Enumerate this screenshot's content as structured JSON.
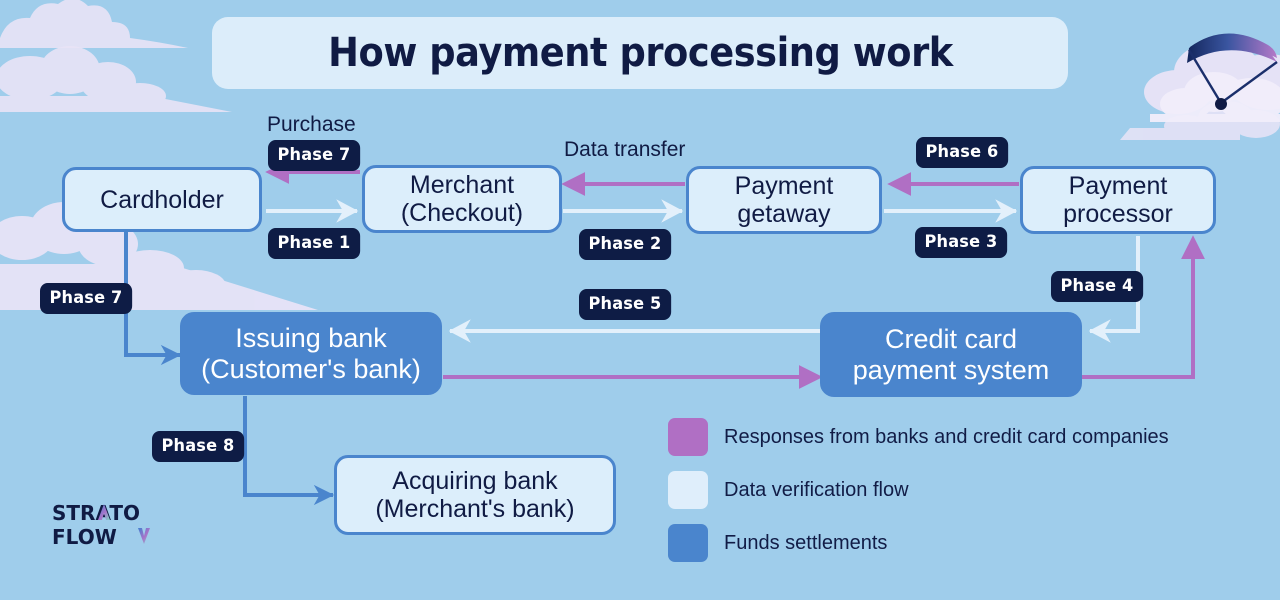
{
  "title": "How payment processing work",
  "background_color": "#9fcdeb",
  "colors": {
    "node_light_fill": "#dceefb",
    "node_border": "#4a85cd",
    "node_solid_fill": "#4a85cd",
    "chip_fill": "#0e1c45",
    "text_navy": "#101b44",
    "arrow_purple": "#b06fc4",
    "arrow_light": "#e3f0fb",
    "arrow_blue": "#4a85cd",
    "title_panel": "#dcedfa"
  },
  "nodes": [
    {
      "id": "cardholder",
      "line1": "Cardholder",
      "line2": ""
    },
    {
      "id": "merchant",
      "line1": "Merchant",
      "line2": "(Checkout)"
    },
    {
      "id": "gateway",
      "line1": "Payment",
      "line2": "getaway"
    },
    {
      "id": "processor",
      "line1": "Payment",
      "line2": "processor"
    },
    {
      "id": "issuing_bank",
      "line1": "Issuing bank",
      "line2": "(Customer's bank)"
    },
    {
      "id": "credit_card",
      "line1": "Credit card",
      "line2": "payment system"
    },
    {
      "id": "acquiring",
      "line1": "Acquiring bank",
      "line2": "(Merchant's bank)"
    }
  ],
  "phases": [
    {
      "id": "p1",
      "label": "Phase 1"
    },
    {
      "id": "p2",
      "label": "Phase 2"
    },
    {
      "id": "p3",
      "label": "Phase 3"
    },
    {
      "id": "p4",
      "label": "Phase 4"
    },
    {
      "id": "p5",
      "label": "Phase 5"
    },
    {
      "id": "p6",
      "label": "Phase 6"
    },
    {
      "id": "p7top",
      "label": "Phase 7"
    },
    {
      "id": "p7left",
      "label": "Phase 7"
    },
    {
      "id": "p8",
      "label": "Phase 8"
    }
  ],
  "flow_labels": {
    "purchase": "Purchase",
    "data_transfer": "Data transfer"
  },
  "legend": [
    {
      "color": "#b06fc4",
      "label": "Responses from banks and credit card companies"
    },
    {
      "color": "#dfeefb",
      "label": "Data verification flow"
    },
    {
      "color": "#4a85cd",
      "label": "Funds settlements"
    }
  ],
  "logo": {
    "line1": "STRATO",
    "line2": "FLOW"
  }
}
